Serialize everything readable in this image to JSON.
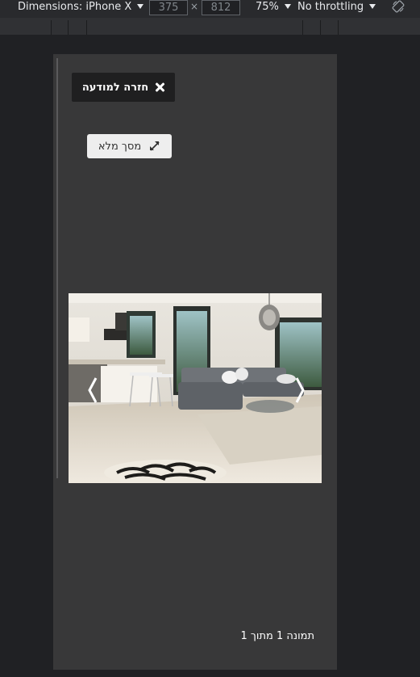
{
  "devtools": {
    "dimensions_label": "Dimensions: iPhone X",
    "width_value": "375",
    "height_value": "812",
    "separator": "×",
    "zoom": "75%",
    "throttling": "No throttling"
  },
  "viewer": {
    "back_button_label": "חזרה למודעה",
    "fullscreen_button_label": "מסך מלא",
    "photo_counter": "תמונה 1 מתוך 1"
  }
}
